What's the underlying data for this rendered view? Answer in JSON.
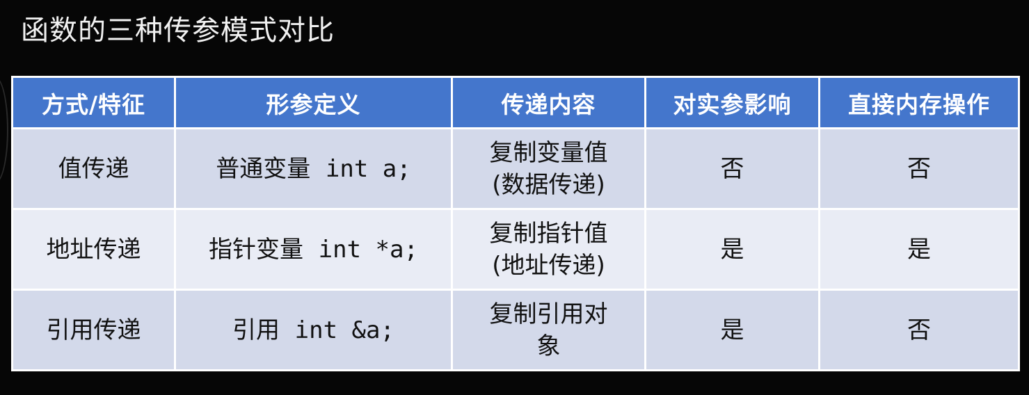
{
  "title": "函数的三种传参模式对比",
  "table": {
    "headers": [
      "方式/特征",
      "形参定义",
      "传递内容",
      "对实参影响",
      "直接内存操作"
    ],
    "rows": [
      {
        "method": "值传递",
        "param_prefix": "普通变量",
        "param_code": "int a;",
        "content_line1": "复制变量值",
        "content_line2": "(数据传递)",
        "affects_arg": "否",
        "direct_memory": "否"
      },
      {
        "method": "地址传递",
        "param_prefix": "指针变量",
        "param_code": "int *a;",
        "content_line1": "复制指针值",
        "content_line2": "(地址传递)",
        "affects_arg": "是",
        "direct_memory": "是"
      },
      {
        "method": "引用传递",
        "param_prefix": "引用",
        "param_code": "int &a;",
        "content_line1": "复制引用对",
        "content_line2": "象",
        "affects_arg": "是",
        "direct_memory": "否"
      }
    ]
  },
  "colors": {
    "background": "#060606",
    "header_fill": "#4476cc",
    "row_fill_a": "#d3d9ea",
    "row_fill_b": "#e9ecf5"
  }
}
